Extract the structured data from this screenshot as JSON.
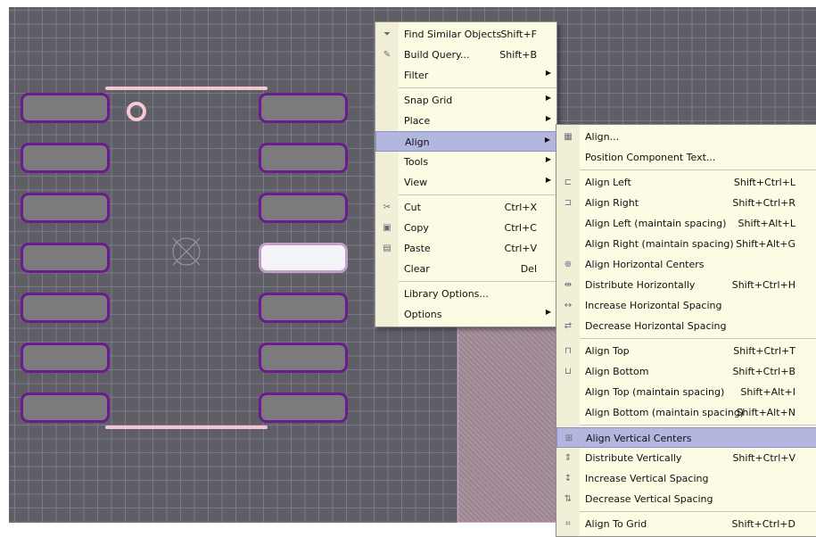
{
  "context_menu": {
    "items": [
      {
        "label": "Find Similar Objects",
        "shortcut": "Shift+F",
        "icon": "find-similar-icon"
      },
      {
        "label": "Build Query...",
        "shortcut": "Shift+B",
        "icon": "build-query-icon"
      },
      {
        "label": "Filter",
        "shortcut": "",
        "submenu": true
      },
      {
        "label": "Snap Grid",
        "shortcut": "",
        "submenu": true
      },
      {
        "label": "Place",
        "shortcut": "",
        "submenu": true
      },
      {
        "label": "Align",
        "shortcut": "",
        "submenu": true,
        "highlighted": true
      },
      {
        "label": "Tools",
        "shortcut": "",
        "submenu": true
      },
      {
        "label": "View",
        "shortcut": "",
        "submenu": true
      },
      {
        "label": "Cut",
        "shortcut": "Ctrl+X",
        "icon": "scissors-icon"
      },
      {
        "label": "Copy",
        "shortcut": "Ctrl+C",
        "icon": "copy-icon"
      },
      {
        "label": "Paste",
        "shortcut": "Ctrl+V",
        "icon": "paste-icon"
      },
      {
        "label": "Clear",
        "shortcut": "Del"
      },
      {
        "label": "Library Options...",
        "shortcut": ""
      },
      {
        "label": "Options",
        "shortcut": "",
        "submenu": true
      }
    ]
  },
  "align_menu": {
    "items": [
      {
        "label": "Align...",
        "shortcut": "",
        "icon": "align-dialog-icon"
      },
      {
        "label": "Position Component Text...",
        "shortcut": ""
      },
      {
        "label": "Align Left",
        "shortcut": "Shift+Ctrl+L",
        "icon": "align-left-icon"
      },
      {
        "label": "Align Right",
        "shortcut": "Shift+Ctrl+R",
        "icon": "align-right-icon"
      },
      {
        "label": "Align Left (maintain spacing)",
        "shortcut": "Shift+Alt+L"
      },
      {
        "label": "Align Right (maintain spacing)",
        "shortcut": "Shift+Alt+G"
      },
      {
        "label": "Align Horizontal Centers",
        "shortcut": "",
        "icon": "align-horizontal-centers-icon"
      },
      {
        "label": "Distribute Horizontally",
        "shortcut": "Shift+Ctrl+H",
        "icon": "distribute-horizontally-icon"
      },
      {
        "label": "Increase Horizontal Spacing",
        "shortcut": "",
        "icon": "increase-horizontal-spacing-icon"
      },
      {
        "label": "Decrease Horizontal Spacing",
        "shortcut": "",
        "icon": "decrease-horizontal-spacing-icon"
      },
      {
        "label": "Align Top",
        "shortcut": "Shift+Ctrl+T",
        "icon": "align-top-icon"
      },
      {
        "label": "Align Bottom",
        "shortcut": "Shift+Ctrl+B",
        "icon": "align-bottom-icon"
      },
      {
        "label": "Align Top (maintain spacing)",
        "shortcut": "Shift+Alt+I"
      },
      {
        "label": "Align Bottom (maintain spacing)",
        "shortcut": "Shift+Alt+N"
      },
      {
        "label": "Align Vertical Centers",
        "shortcut": "",
        "icon": "align-vertical-centers-icon",
        "highlighted": true
      },
      {
        "label": "Distribute Vertically",
        "shortcut": "Shift+Ctrl+V",
        "icon": "distribute-vertically-icon"
      },
      {
        "label": "Increase Vertical Spacing",
        "shortcut": "",
        "icon": "increase-vertical-spacing-icon"
      },
      {
        "label": "Decrease Vertical Spacing",
        "shortcut": "",
        "icon": "decrease-vertical-spacing-icon"
      },
      {
        "label": "Align To Grid",
        "shortcut": "Shift+Ctrl+D",
        "icon": "align-to-grid-icon"
      }
    ]
  },
  "colors": {
    "canvas_background": "#5f5e64",
    "grid_line": "#7d7c96",
    "pad_fill": "#7b7b7d",
    "pad_outline": "#6b1b8f",
    "selected_pad_fill": "#f4f4f8",
    "silkscreen": "#f5c4d2",
    "menu_background": "#fcfbe4",
    "menu_highlight": "#b3b6df"
  }
}
